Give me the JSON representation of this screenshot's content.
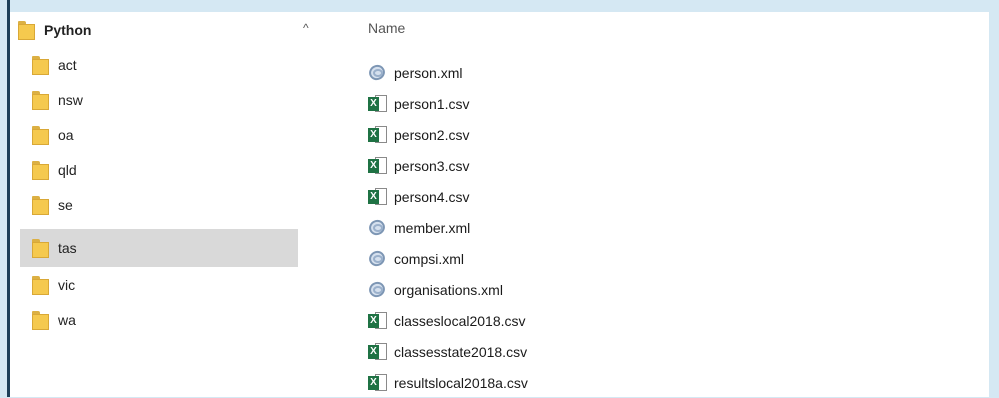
{
  "nav": {
    "root": "Python",
    "folders": [
      "act",
      "nsw",
      "oa",
      "qld",
      "se",
      "tas",
      "vic",
      "wa"
    ],
    "selected": "tas",
    "collapse_glyph": "^"
  },
  "files": {
    "column_header": "Name",
    "items": [
      {
        "name": "person.xml",
        "type": "xml"
      },
      {
        "name": "person1.csv",
        "type": "csv"
      },
      {
        "name": "person2.csv",
        "type": "csv"
      },
      {
        "name": "person3.csv",
        "type": "csv"
      },
      {
        "name": "person4.csv",
        "type": "csv"
      },
      {
        "name": "member.xml",
        "type": "xml"
      },
      {
        "name": "compsi.xml",
        "type": "xml"
      },
      {
        "name": "organisations.xml",
        "type": "xml"
      },
      {
        "name": "classeslocal2018.csv",
        "type": "csv"
      },
      {
        "name": "classesstate2018.csv",
        "type": "csv"
      },
      {
        "name": "resultslocal2018a.csv",
        "type": "csv"
      }
    ]
  },
  "icons": {
    "folder": "folder-icon",
    "xml": "xml-file-icon",
    "csv": "excel-csv-icon"
  },
  "colors": {
    "background": "#d5e8f3",
    "selection": "#d9d9d9",
    "folder": "#f5c94e",
    "excel": "#1f7244"
  }
}
